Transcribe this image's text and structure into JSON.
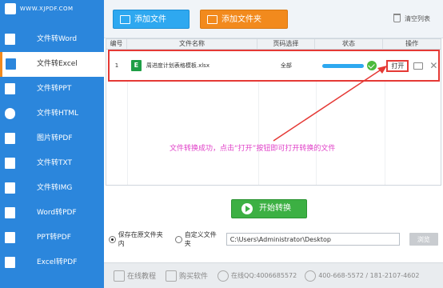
{
  "logo": {
    "url": "WWW.XJPDF.COM"
  },
  "sidebar": {
    "items": [
      {
        "label": "文件转Word",
        "icon": "word-icon"
      },
      {
        "label": "文件转Excel",
        "icon": "excel-icon",
        "active": true
      },
      {
        "label": "文件转PPT",
        "icon": "ppt-icon"
      },
      {
        "label": "文件转HTML",
        "icon": "globe-icon"
      },
      {
        "label": "图片转PDF",
        "icon": "image-icon"
      },
      {
        "label": "文件转TXT",
        "icon": "txt-icon"
      },
      {
        "label": "文件转IMG",
        "icon": "img-icon"
      },
      {
        "label": "Word转PDF",
        "icon": "pdf-icon"
      },
      {
        "label": "PPT转PDF",
        "icon": "pdf-icon"
      },
      {
        "label": "Excel转PDF",
        "icon": "pdf-icon"
      }
    ]
  },
  "toolbar": {
    "add_file": "添加文件",
    "add_folder": "添加文件夹",
    "clear_list": "清空列表"
  },
  "table": {
    "headers": [
      "编号",
      "文件名称",
      "页码选择",
      "状态",
      "操作"
    ],
    "rows": [
      {
        "index": "1",
        "filename": "周进度计划表格模板.xlsx",
        "pages": "全部",
        "progress": 1.0,
        "action": "打开"
      }
    ]
  },
  "annotation": "文件转换成功，点击“打开”按钮即可打开转换的文件",
  "convert": {
    "label": "开始转换"
  },
  "output": {
    "option_source": "保存在原文件夹内",
    "option_custom": "自定义文件夹",
    "path": "C:\\Users\\Administrator\\Desktop",
    "browse": "浏览"
  },
  "footer": {
    "tutorial": "在线教程",
    "buy": "购买软件",
    "qq": "在线QQ:4006685572",
    "phone": "400-668-5572 / 181-2107-4602"
  },
  "colors": {
    "sidebar": "#2b86dc",
    "add_file": "#2ea8f0",
    "add_folder": "#f28a1d",
    "convert": "#3cb043",
    "highlight": "#e53935",
    "annotation": "#e040c8"
  }
}
